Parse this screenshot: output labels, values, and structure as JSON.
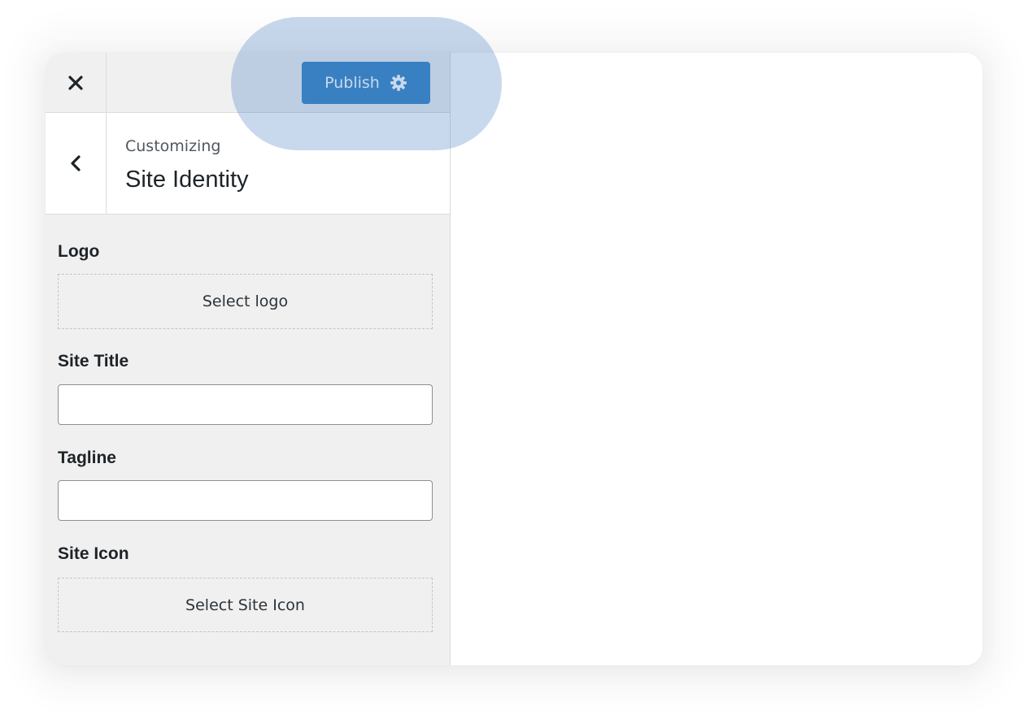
{
  "topbar": {
    "close_icon": "close-icon",
    "publish_label": "Publish",
    "publish_icon": "gear-icon",
    "accent_color": "#3a84c4"
  },
  "section": {
    "back_icon": "chevron-left-icon",
    "context_label": "Customizing",
    "title": "Site Identity"
  },
  "controls": {
    "logo": {
      "label": "Logo",
      "button_label": "Select logo"
    },
    "site_title": {
      "label": "Site Title",
      "value": ""
    },
    "tagline": {
      "label": "Tagline",
      "value": ""
    },
    "site_icon": {
      "label": "Site Icon",
      "button_label": "Select Site Icon"
    }
  }
}
